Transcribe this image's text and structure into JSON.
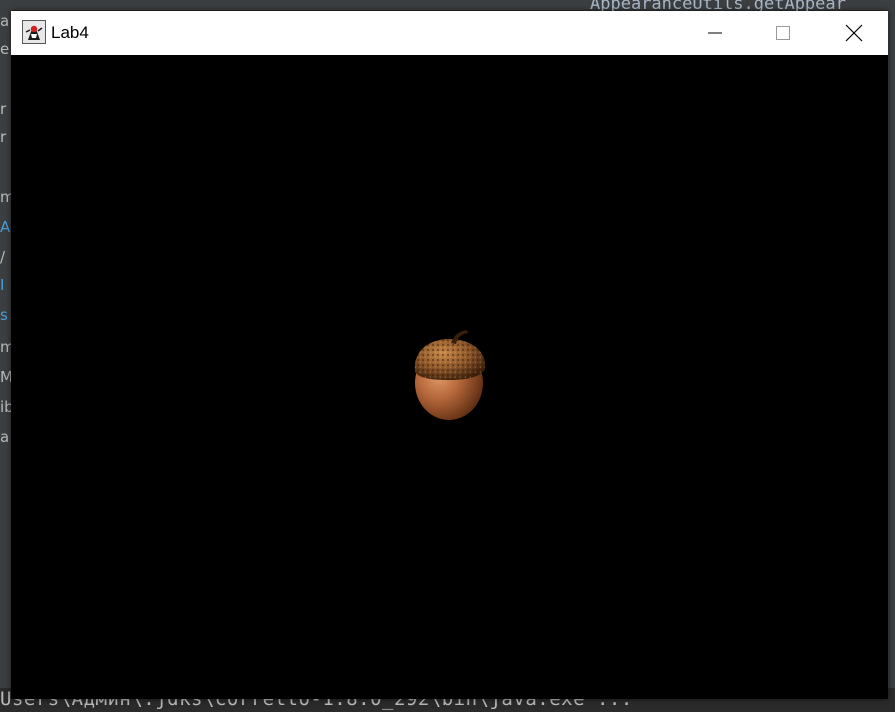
{
  "background": {
    "top_code_text": "AppearanceUtils.getAppear",
    "terminal_text": "Users\\Админ\\.jdks\\corretto-1.8.0_292\\bin\\java.exe ...",
    "left_fragments": [
      "a",
      "e",
      "r",
      "r",
      "m",
      "A",
      "/",
      "I",
      "s",
      "m",
      "M",
      "ib",
      "a"
    ]
  },
  "window": {
    "title": "Lab4",
    "icon": "java-duke-icon",
    "controls": {
      "minimize": "minimize-icon",
      "maximize": "maximize-icon",
      "close": "close-icon"
    }
  },
  "scene": {
    "background_color": "#000000",
    "object": "acorn",
    "cap_color": "#8a5428",
    "nut_color": "#b5673a"
  }
}
